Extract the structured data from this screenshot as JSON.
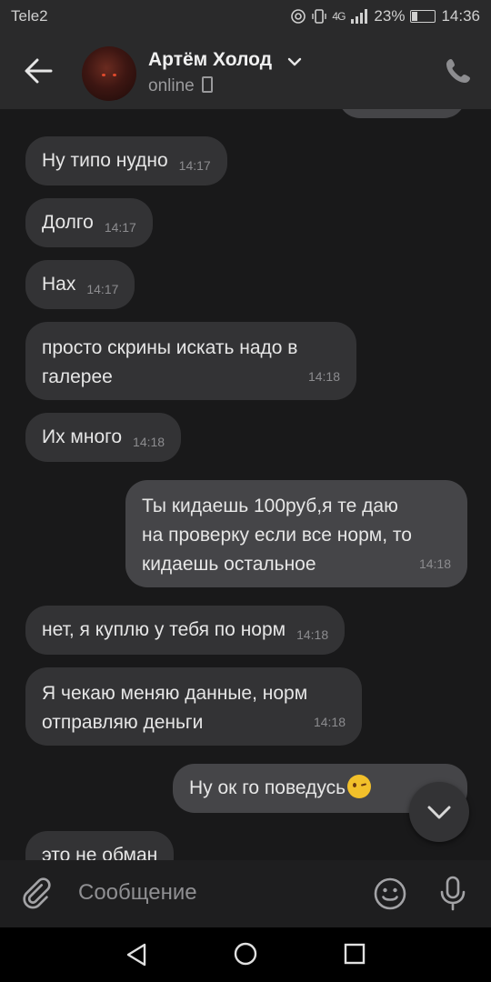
{
  "statusbar": {
    "carrier": "Tele2",
    "network": "4G",
    "battery": "23%",
    "time": "14:36"
  },
  "header": {
    "name": "Артём Холод",
    "status": "online"
  },
  "messages": [
    {
      "dir": "in",
      "text": "Ну типо нудно",
      "time": "14:17"
    },
    {
      "dir": "in",
      "text": "Долго",
      "time": "14:17"
    },
    {
      "dir": "in",
      "text": "Нах",
      "time": "14:17"
    },
    {
      "dir": "in",
      "lines": [
        "просто скрины искать надо в",
        "галерее"
      ],
      "time": "14:18"
    },
    {
      "dir": "in",
      "text": "Их много",
      "time": "14:18"
    },
    {
      "dir": "out",
      "lines": [
        "Ты кидаешь 100руб,я те даю",
        "на проверку если все норм, то",
        "кидаешь остальное"
      ],
      "time": "14:18"
    },
    {
      "dir": "in",
      "text": "нет, я куплю у тебя по норм",
      "time": "14:18"
    },
    {
      "dir": "in",
      "lines": [
        "Я чекаю меняю данные, норм",
        "отправляю деньги"
      ],
      "time": "14:18"
    },
    {
      "dir": "out",
      "text": "Ну ок го поведусь",
      "emoji": "wink"
    },
    {
      "dir": "in",
      "text": "это не обман"
    }
  ],
  "composer": {
    "placeholder": "Сообщение"
  }
}
